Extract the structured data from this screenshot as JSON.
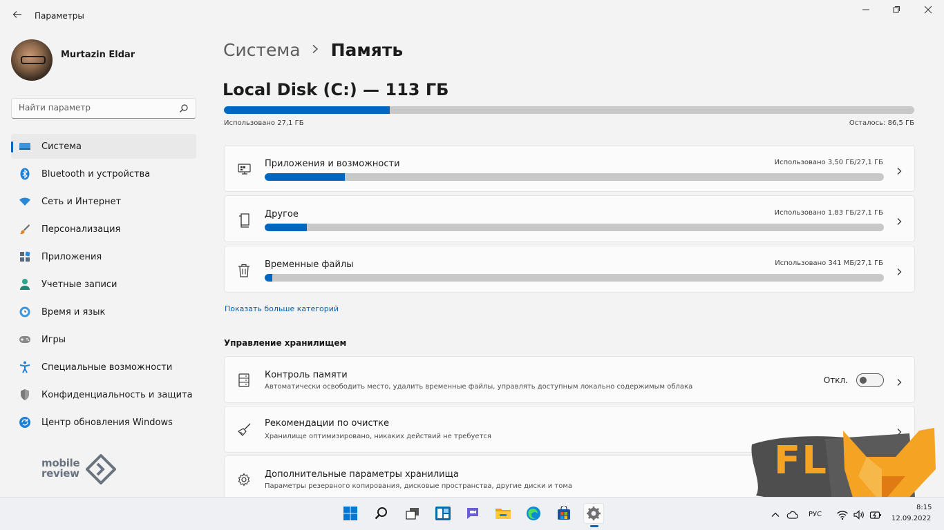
{
  "window": {
    "title": "Параметры"
  },
  "user": {
    "name": "Murtazin Eldar"
  },
  "search": {
    "placeholder": "Найти параметр"
  },
  "sidebar": {
    "items": [
      {
        "label": "Система",
        "icon": "system-icon",
        "active": true
      },
      {
        "label": "Bluetooth и устройства",
        "icon": "bluetooth-icon"
      },
      {
        "label": "Сеть и Интернет",
        "icon": "wifi-icon"
      },
      {
        "label": "Персонализация",
        "icon": "brush-icon"
      },
      {
        "label": "Приложения",
        "icon": "apps-icon"
      },
      {
        "label": "Учетные записи",
        "icon": "account-icon"
      },
      {
        "label": "Время и язык",
        "icon": "globe-clock-icon"
      },
      {
        "label": "Игры",
        "icon": "gamepad-icon"
      },
      {
        "label": "Специальные возможности",
        "icon": "accessibility-icon"
      },
      {
        "label": "Конфиденциальность и защита",
        "icon": "shield-icon"
      },
      {
        "label": "Центр обновления Windows",
        "icon": "update-icon"
      }
    ]
  },
  "logo": {
    "line1": "mobile",
    "line2": "review"
  },
  "breadcrumb": {
    "parent": "Система",
    "current": "Память"
  },
  "disk": {
    "title": "Local Disk (C:) — 113 ГБ",
    "used_text": "Использовано 27,1 ГБ",
    "free_text": "Осталось: 86,5 ГБ",
    "used_fraction": 0.24
  },
  "categories": [
    {
      "label": "Приложения и возможности",
      "value": "Использовано 3,50 ГБ/27,1 ГБ",
      "fraction": 0.129,
      "icon": "apps-features-icon"
    },
    {
      "label": "Другое",
      "value": "Использовано 1,83 ГБ/27,1 ГБ",
      "fraction": 0.068,
      "icon": "other-files-icon"
    },
    {
      "label": "Временные файлы",
      "value": "Использовано 341 МБ/27,1 ГБ",
      "fraction": 0.012,
      "icon": "trash-icon"
    }
  ],
  "show_more": "Показать больше категорий",
  "management": {
    "title": "Управление хранилищем",
    "items": [
      {
        "label": "Контроль памяти",
        "desc": "Автоматически освободить место, удалить временные файлы, управлять доступным локально содержимым облака",
        "toggle_label": "Откл.",
        "toggle_on": false,
        "icon": "storage-sense-icon"
      },
      {
        "label": "Рекомендации по очистке",
        "desc": "Хранилище оптимизировано, никаких действий не требуется",
        "icon": "broom-icon"
      },
      {
        "label": "Дополнительные параметры хранилища",
        "desc": "Параметры резервного копирования, дисковые пространства, другие диски и тома",
        "icon": "gear-icon"
      }
    ]
  },
  "watermark": {
    "text": "FL"
  },
  "taskbar": {
    "language": "РУС",
    "time": "8:15",
    "date": "12.09.2022"
  },
  "colors": {
    "accent": "#0067c0",
    "bar_track": "#c8c8c8",
    "background": "#f3f3f3",
    "card": "#fbfbfb"
  }
}
